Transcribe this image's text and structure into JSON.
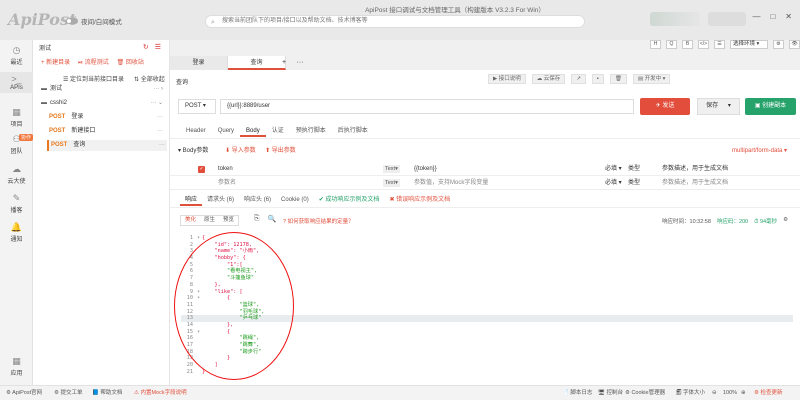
{
  "app": {
    "logo": "ApiPost",
    "theme_toggle_label": "夜间/白间模式",
    "window_title": "ApiPost 接口调试与文档管理工具（构建版本 V3.2.3 For Win）",
    "search_placeholder": "搜索当前团队下的项目/接口以及帮助文档、技术博客等",
    "window_buttons": [
      "—",
      "□",
      "✕"
    ]
  },
  "left_nav": [
    {
      "label": "最近",
      "icon": "clock-icon",
      "glyph": "◷"
    },
    {
      "label": "APIs",
      "icon": "api-icon",
      "glyph": ">_"
    },
    {
      "label": "项目",
      "icon": "project-icon",
      "glyph": "▦"
    },
    {
      "label": "团队",
      "icon": "team-icon",
      "glyph": "⚇",
      "badge": "协作"
    },
    {
      "label": "云大使",
      "icon": "cloud-icon",
      "glyph": "☁"
    },
    {
      "label": "播客",
      "icon": "edit-icon",
      "glyph": "✎"
    },
    {
      "label": "通知",
      "icon": "bell-icon",
      "glyph": "🔔"
    },
    {
      "label": "应用",
      "icon": "apps-icon",
      "glyph": "▦"
    }
  ],
  "tree": {
    "title": "测试",
    "actions": [
      "+ 新建目录",
      "⏯ 流程测试",
      "🗑 回收站"
    ],
    "filter": [
      "☰ 定位到当前接口目录",
      "⇅ 全部收起"
    ],
    "rows": [
      {
        "type": "folder",
        "label": "测试"
      },
      {
        "type": "folder",
        "label": "csshi2"
      },
      {
        "type": "api",
        "method": "POST",
        "label": "登录"
      },
      {
        "type": "api",
        "method": "POST",
        "label": "新建接口"
      },
      {
        "type": "api",
        "method": "POST",
        "label": "查询"
      }
    ]
  },
  "tabs": [
    {
      "label": "登录"
    },
    {
      "label": "查询"
    }
  ],
  "tab_more": "···",
  "tab_add": "+",
  "toolbar": {
    "icons": [
      "H",
      "Q",
      "B",
      "</>",
      "☰"
    ],
    "env_select": "选择环境 ▾",
    "env_icons": [
      "⚙",
      "👁"
    ]
  },
  "api": {
    "name": "查询",
    "tools": [
      "▶ 接口说明",
      "☁ 云保存",
      "↗",
      "▪",
      "🗑",
      "▤ 开发中 ▾"
    ],
    "method": "POST ▾",
    "url": "{{url}}:8889/user",
    "send": "✈ 发送",
    "save": "保存",
    "save_arrow": "▾",
    "share": "▣ 创建副本"
  },
  "req_tabs": [
    "Header",
    "Query",
    "Body",
    "认证",
    "预执行脚本",
    "后执行脚本"
  ],
  "body_bar": {
    "label": "▾ Body参数",
    "import": "⬇ 导入参数",
    "export": "⬆ 导出参数",
    "content_type": "multipart/form-data ▾"
  },
  "params": [
    {
      "checked": true,
      "name": "token",
      "type": "Text▾",
      "value": "{{token}}",
      "required": "必填 ▾",
      "param_type": "类型",
      "desc": "参数描述，用于生成文档"
    },
    {
      "checked": false,
      "name": "参数名",
      "type": "Text▾",
      "value": "参数值，支持Mock字段变量",
      "required": "必填 ▾",
      "param_type": "类型",
      "desc": "参数描述，用于生成文档"
    }
  ],
  "resp_tabs": [
    "响应",
    "请求头 (6)",
    "响应头 (6)",
    "Cookie (0)",
    "✔ 成功响应示例及文档",
    "✖ 错误响应示例及文档"
  ],
  "view_toggles": [
    "美化",
    "原生",
    "预览"
  ],
  "resp_tools": [
    "⎘",
    "🔍"
  ],
  "resp_tip": "? 如何获取响应结果的定量？",
  "resp_meta": {
    "time": "响应时间：10:32:58",
    "status": "响应码：200",
    "size": "⏱ 94毫秒",
    "gear": "⚙"
  },
  "code_lines": [
    {
      "n": "1",
      "fold": "▾",
      "text": "{"
    },
    {
      "n": "2",
      "fold": "",
      "text": "    \"id\": 12178,"
    },
    {
      "n": "3",
      "fold": "",
      "text": "    \"name\": \"小雨\","
    },
    {
      "n": "4",
      "fold": "",
      "text": "    \"hobby\": {"
    },
    {
      "n": "5",
      "fold": "",
      "text": "        \"1\":["
    },
    {
      "n": "6",
      "fold": "",
      "text": "        \"看电视主\","
    },
    {
      "n": "7",
      "fold": "",
      "text": "        \"斗篷鱼球\""
    },
    {
      "n": "8",
      "fold": "",
      "text": "    },"
    },
    {
      "n": "9",
      "fold": "▾",
      "text": "    \"like\": ["
    },
    {
      "n": "10",
      "fold": "▾",
      "text": "        {"
    },
    {
      "n": "11",
      "fold": "",
      "text": "            \"篮球\","
    },
    {
      "n": "12",
      "fold": "",
      "text": "            \"羽毛球\","
    },
    {
      "n": "13",
      "fold": "",
      "text": "            \"乒乓球\""
    },
    {
      "n": "14",
      "fold": "",
      "text": "        },"
    },
    {
      "n": "15",
      "fold": "▾",
      "text": "        {"
    },
    {
      "n": "16",
      "fold": "",
      "text": "            \"跳绳\","
    },
    {
      "n": "17",
      "fold": "",
      "text": "            \"跳舞\","
    },
    {
      "n": "18",
      "fold": "",
      "text": "            \"跨步行\""
    },
    {
      "n": "19",
      "fold": "",
      "text": "        }"
    },
    {
      "n": "20",
      "fold": "",
      "text": "    ]"
    },
    {
      "n": "21",
      "fold": "",
      "text": "}"
    }
  ],
  "statusbar": {
    "items": [
      "⚙ ApiPost官网",
      "⚙ 提交工单",
      "📘 帮助文档",
      "⚠ 内置Mock字段说明"
    ],
    "right": [
      "📄 脚本日志",
      "🖥 控制台",
      "⚙ Cookie管理器",
      "🗐 字体大小",
      "⊖",
      "100%",
      "⊕",
      "⚙ 检查更新"
    ]
  },
  "colors": {
    "accent": "#e24e3b",
    "post": "#e8791e",
    "share": "#26a26b"
  }
}
